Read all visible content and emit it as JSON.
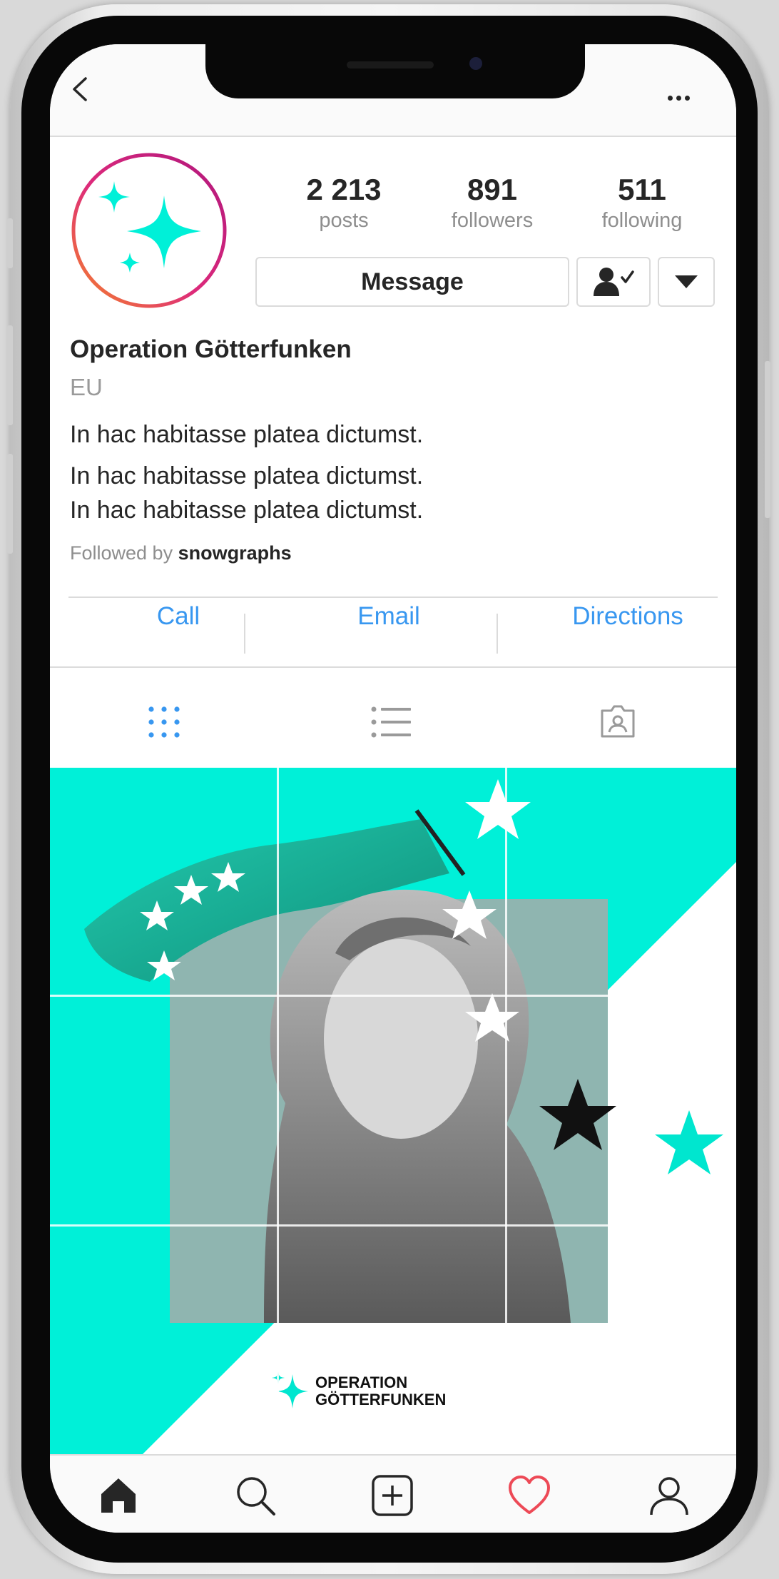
{
  "profile": {
    "name": "Operation Götterfunken",
    "category": "EU",
    "bio": [
      "In hac habitasse platea dictumst.",
      "In hac habitasse platea dictumst.",
      "In hac habitasse platea dictumst."
    ],
    "followed_by_prefix": "Followed by",
    "followed_by_user": "snowgraphs"
  },
  "stats": [
    {
      "value": "2 213",
      "label": "posts"
    },
    {
      "value": "891",
      "label": "followers"
    },
    {
      "value": "511",
      "label": "following"
    }
  ],
  "buttons": {
    "message": "Message",
    "follow_icon": "user-check-icon",
    "dropdown_icon": "caret-down-icon"
  },
  "contact": {
    "call": "Call",
    "email": "Email",
    "directions": "Directions"
  },
  "tabs": [
    {
      "icon": "grid-icon",
      "active": true
    },
    {
      "icon": "list-icon",
      "active": false
    },
    {
      "icon": "tagged-icon",
      "active": false
    }
  ],
  "post": {
    "logo_line1": "OPERATION",
    "logo_line2": "GÖTTERFUNKEN"
  },
  "bottom_nav": [
    {
      "icon": "home-icon"
    },
    {
      "icon": "search-icon"
    },
    {
      "icon": "add-post-icon"
    },
    {
      "icon": "heart-icon"
    },
    {
      "icon": "profile-icon"
    }
  ],
  "colors": {
    "accent": "#3897f0",
    "brand_mint": "#00f0d8",
    "heart": "#ed4956",
    "text": "#262626",
    "muted": "#8e8e8e"
  }
}
